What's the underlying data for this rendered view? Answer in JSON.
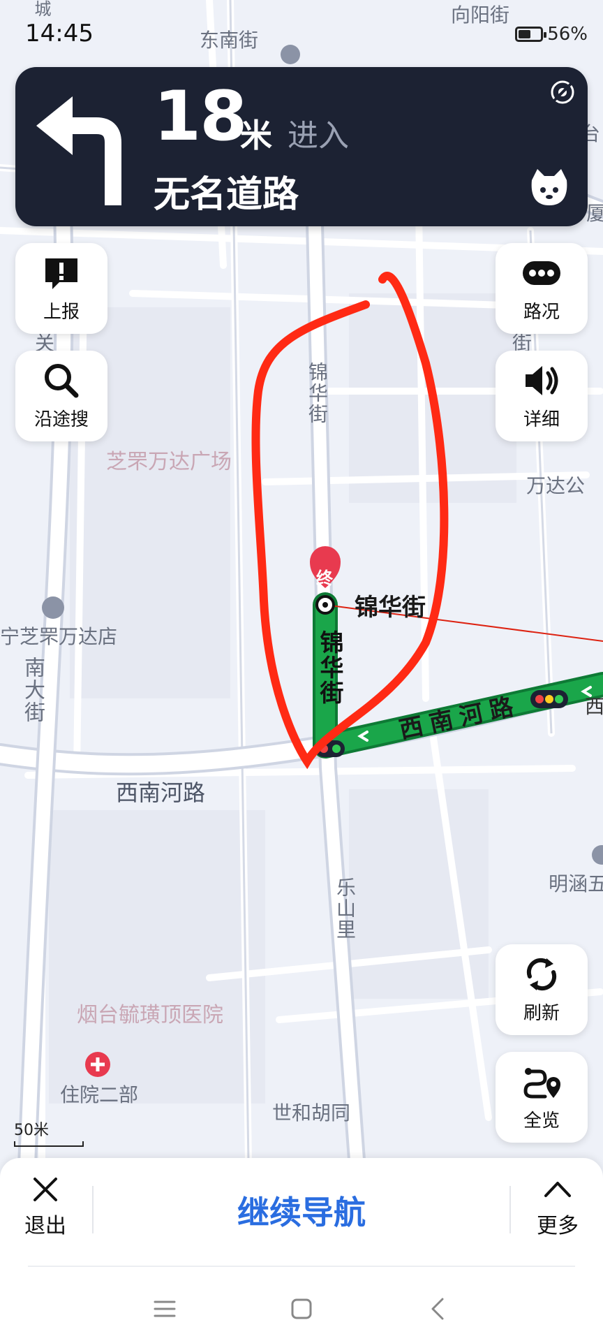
{
  "status_bar": {
    "time": "14:45",
    "battery": "56%",
    "battery_level": 0.56
  },
  "navigation": {
    "distance": "18",
    "unit": "米",
    "action": "进入",
    "road": "无名道路",
    "maneuver_icon": "turn-left-icon"
  },
  "left_buttons": [
    {
      "label": "上报",
      "icon": "report-icon"
    },
    {
      "label": "沿途搜",
      "icon": "search-icon"
    }
  ],
  "right_buttons": [
    {
      "label": "路况",
      "icon": "traffic-icon"
    },
    {
      "label": "详细",
      "icon": "speaker-icon"
    },
    {
      "label": "刷新",
      "icon": "refresh-icon"
    },
    {
      "label": "全览",
      "icon": "overview-icon"
    }
  ],
  "map_labels": {
    "dongnan_jie": "东南街",
    "xiangyang_jie": "向阳街",
    "wanda_plaza": "芝罘万达广场",
    "wanda_store": "宁芝罘万达店",
    "wanda_apartment": "万达公",
    "jinhua_jie_v": "锦华街",
    "jinhua_jie_dest": "锦华街",
    "jinhua_jie_route": "锦华街",
    "xinan_he_lu": "西南河路",
    "xinan_he_lu_route": "西南河路",
    "nan_da_jie": "南大街",
    "leshan_li": "乐山里",
    "hospital": "烟台毓璜顶医院",
    "hospital_dept": "住院二部",
    "shihe_hutong": "世和胡同",
    "mingyuan": "明涵五",
    "edge_tai": "台",
    "edge_xia": "厦",
    "edge_guan": "关",
    "edge_jie": "街",
    "edge_cheng": "城",
    "edge_xi": "西",
    "destination_marker": "终"
  },
  "scale_label": "50米",
  "bottom_bar": {
    "exit_label": "退出",
    "continue_label": "继续导航",
    "more_label": "更多"
  },
  "colors": {
    "nav_card_bg": "#1c2233",
    "route_green": "#1aa64a",
    "accent_blue": "#2a6de0",
    "annotation_red": "#ff2a14",
    "destination_red": "#e83a4f"
  }
}
